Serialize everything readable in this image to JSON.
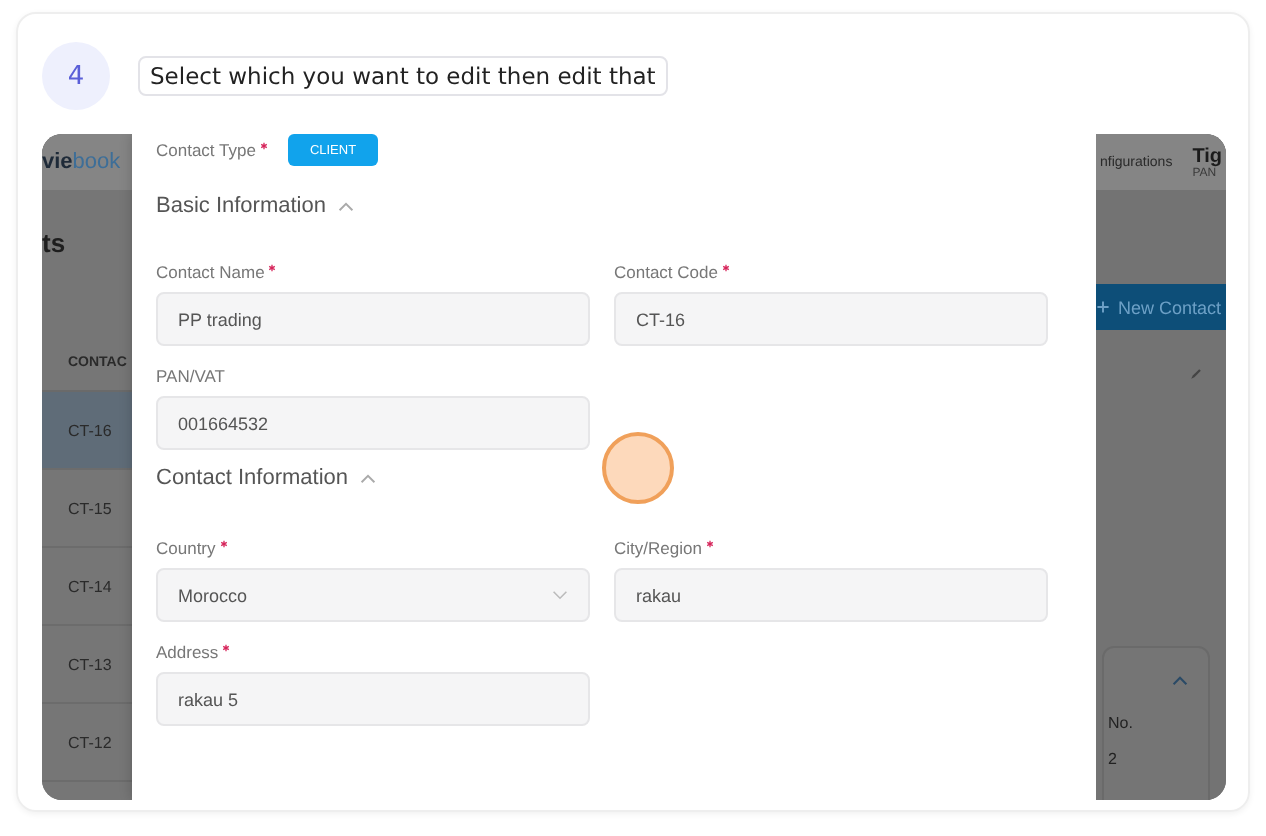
{
  "step": {
    "number": "4",
    "instruction": "Select which you want to edit then edit that"
  },
  "background": {
    "logo": {
      "dark": "vie",
      "blue": "book"
    },
    "page_title": "ts",
    "table_header": "CONTAC",
    "nav_item": "nfigurations",
    "user": {
      "name": "Tig",
      "sub": "PAN"
    },
    "new_button": "New Contact",
    "panel": {
      "label": "No.",
      "value": "2"
    },
    "rows": [
      {
        "code": "CT-16",
        "selected": true
      },
      {
        "code": "CT-15",
        "selected": false
      },
      {
        "code": "CT-14",
        "selected": false
      },
      {
        "code": "CT-13",
        "selected": false
      },
      {
        "code": "CT-12",
        "selected": false
      }
    ]
  },
  "modal": {
    "contact_type": {
      "label": "Contact Type",
      "required": true,
      "button": "CLIENT"
    },
    "sections": [
      {
        "title": "Basic Information",
        "expanded": true,
        "fields": [
          {
            "label": "Contact Name",
            "required": true,
            "value": "PP trading",
            "kind": "input"
          },
          {
            "label": "Contact Code",
            "required": true,
            "value": "CT-16",
            "kind": "input"
          },
          {
            "label": "PAN/VAT",
            "required": false,
            "value": "001664532",
            "kind": "input"
          }
        ]
      },
      {
        "title": "Contact Information",
        "expanded": true,
        "fields": [
          {
            "label": "Country",
            "required": true,
            "value": "Morocco",
            "kind": "select"
          },
          {
            "label": "City/Region",
            "required": true,
            "value": "rakau",
            "kind": "input"
          },
          {
            "label": "Address",
            "required": true,
            "value": "rakau 5",
            "kind": "input"
          }
        ]
      }
    ]
  }
}
